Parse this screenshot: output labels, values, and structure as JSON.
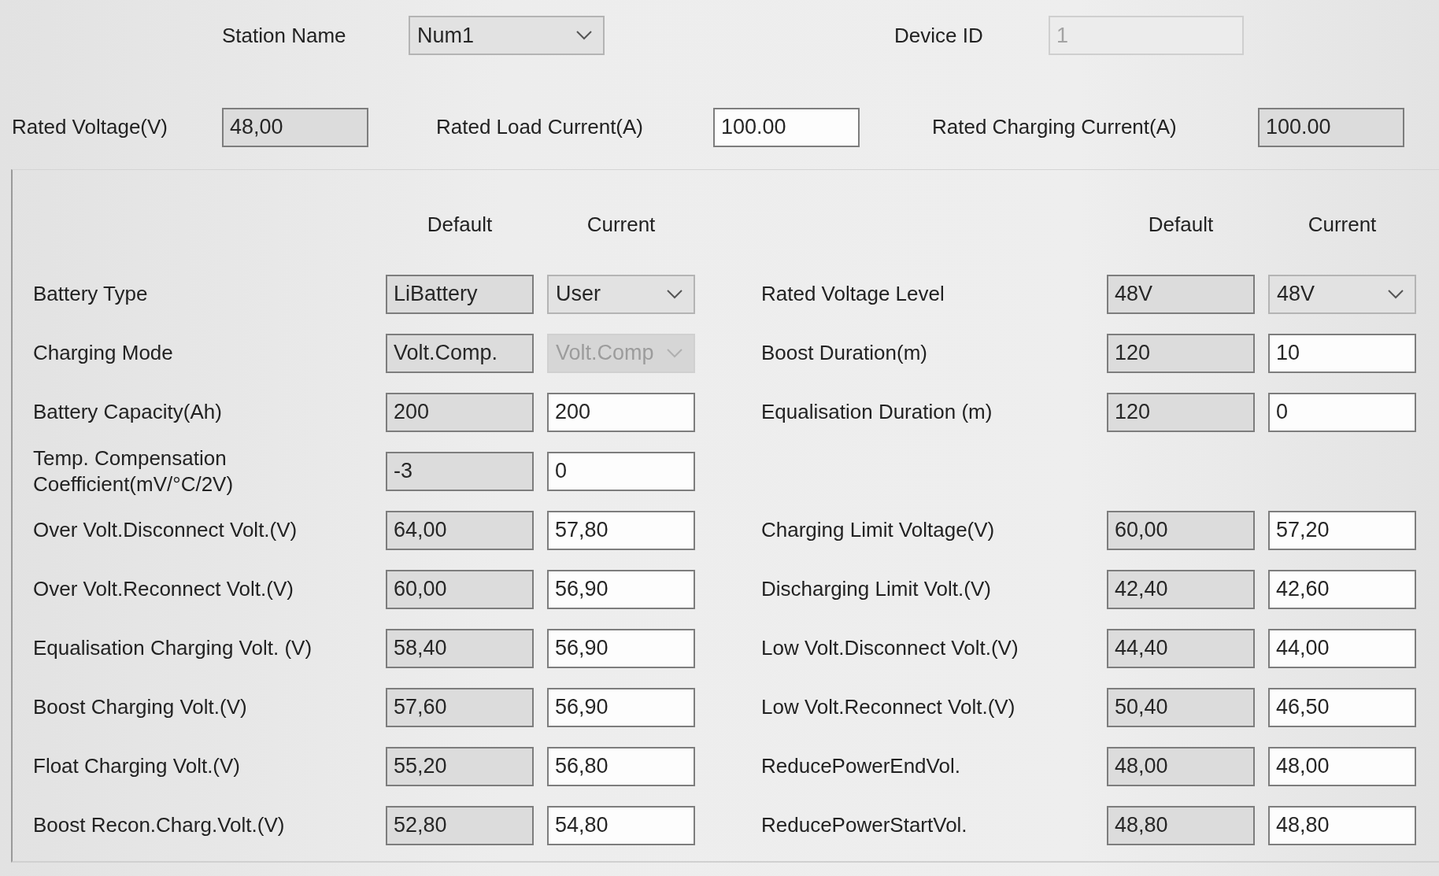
{
  "station": {
    "label": "Station Name",
    "field": {
      "kind": "combo",
      "value": "Num1",
      "disabled": false
    }
  },
  "device": {
    "label": "Device ID",
    "field": {
      "kind": "text",
      "value": "1",
      "disabled": true
    }
  },
  "ratings": [
    {
      "label": "Rated Voltage(V)",
      "field": {
        "kind": "text",
        "value": "48,00",
        "disabled": false,
        "readonly": true
      }
    },
    {
      "label": "Rated Load Current(A)",
      "field": {
        "kind": "text",
        "value": "100.00",
        "disabled": false,
        "readonly": false
      }
    },
    {
      "label": "Rated Charging Current(A)",
      "field": {
        "kind": "text",
        "value": "100.00",
        "disabled": false,
        "readonly": true
      }
    }
  ],
  "left_panel": {
    "column_headers": [
      "Default",
      "Current"
    ],
    "rows": [
      {
        "label": "Battery Type",
        "default": {
          "kind": "text",
          "value": "LiBattery",
          "disabled": false,
          "readonly": true
        },
        "current": {
          "kind": "combo",
          "value": "User",
          "disabled": false
        }
      },
      {
        "label": "Charging Mode",
        "default": {
          "kind": "text",
          "value": "Volt.Comp.",
          "disabled": false,
          "readonly": true
        },
        "current": {
          "kind": "combo",
          "value": "Volt.Comp",
          "disabled": true
        }
      },
      {
        "label": "Battery Capacity(Ah)",
        "default": {
          "kind": "text",
          "value": "200",
          "disabled": false,
          "readonly": true
        },
        "current": {
          "kind": "text",
          "value": "200",
          "disabled": false,
          "readonly": false
        }
      },
      {
        "label": "Temp. Compensation\nCoefficient(mV/°C/2V)",
        "default": {
          "kind": "text",
          "value": "-3",
          "disabled": false,
          "readonly": true
        },
        "current": {
          "kind": "text",
          "value": "0",
          "disabled": false,
          "readonly": false
        }
      },
      {
        "label": "Over Volt.Disconnect Volt.(V)",
        "default": {
          "kind": "text",
          "value": "64,00",
          "disabled": false,
          "readonly": true
        },
        "current": {
          "kind": "text",
          "value": "57,80",
          "disabled": false,
          "readonly": false
        }
      },
      {
        "label": "Over Volt.Reconnect Volt.(V)",
        "default": {
          "kind": "text",
          "value": "60,00",
          "disabled": false,
          "readonly": true
        },
        "current": {
          "kind": "text",
          "value": "56,90",
          "disabled": false,
          "readonly": false
        }
      },
      {
        "label": "Equalisation Charging Volt. (V)",
        "default": {
          "kind": "text",
          "value": "58,40",
          "disabled": false,
          "readonly": true
        },
        "current": {
          "kind": "text",
          "value": "56,90",
          "disabled": false,
          "readonly": false
        }
      },
      {
        "label": "Boost Charging Volt.(V)",
        "default": {
          "kind": "text",
          "value": "57,60",
          "disabled": false,
          "readonly": true
        },
        "current": {
          "kind": "text",
          "value": "56,90",
          "disabled": false,
          "readonly": false
        }
      },
      {
        "label": "Float Charging Volt.(V)",
        "default": {
          "kind": "text",
          "value": "55,20",
          "disabled": false,
          "readonly": true
        },
        "current": {
          "kind": "text",
          "value": "56,80",
          "disabled": false,
          "readonly": false
        }
      },
      {
        "label": "Boost Recon.Charg.Volt.(V)",
        "default": {
          "kind": "text",
          "value": "52,80",
          "disabled": false,
          "readonly": true
        },
        "current": {
          "kind": "text",
          "value": "54,80",
          "disabled": false,
          "readonly": false
        }
      }
    ]
  },
  "right_panel": {
    "column_headers": [
      "Default",
      "Current"
    ],
    "groups": [
      {
        "rows": [
          {
            "label": "Rated Voltage Level",
            "default": {
              "kind": "text",
              "value": "48V",
              "disabled": false,
              "readonly": true
            },
            "current": {
              "kind": "combo",
              "value": "48V",
              "disabled": false
            }
          },
          {
            "label": "Boost Duration(m)",
            "default": {
              "kind": "text",
              "value": "120",
              "disabled": false,
              "readonly": true
            },
            "current": {
              "kind": "text",
              "value": "10",
              "disabled": false,
              "readonly": false
            }
          },
          {
            "label": "Equalisation Duration (m)",
            "default": {
              "kind": "text",
              "value": "120",
              "disabled": false,
              "readonly": true
            },
            "current": {
              "kind": "text",
              "value": "0",
              "disabled": false,
              "readonly": false
            }
          }
        ]
      },
      {
        "rows": [
          {
            "label": "Charging Limit Voltage(V)",
            "default": {
              "kind": "text",
              "value": "60,00",
              "disabled": false,
              "readonly": true
            },
            "current": {
              "kind": "text",
              "value": "57,20",
              "disabled": false,
              "readonly": false
            }
          },
          {
            "label": "Discharging Limit Volt.(V)",
            "default": {
              "kind": "text",
              "value": "42,40",
              "disabled": false,
              "readonly": true
            },
            "current": {
              "kind": "text",
              "value": "42,60",
              "disabled": false,
              "readonly": false
            }
          },
          {
            "label": "Low Volt.Disconnect Volt.(V)",
            "default": {
              "kind": "text",
              "value": "44,40",
              "disabled": false,
              "readonly": true
            },
            "current": {
              "kind": "text",
              "value": "44,00",
              "disabled": false,
              "readonly": false
            }
          },
          {
            "label": "Low Volt.Reconnect Volt.(V)",
            "default": {
              "kind": "text",
              "value": "50,40",
              "disabled": false,
              "readonly": true
            },
            "current": {
              "kind": "text",
              "value": "46,50",
              "disabled": false,
              "readonly": false
            }
          },
          {
            "label": "ReducePowerEndVol.",
            "default": {
              "kind": "text",
              "value": "48,00",
              "disabled": false,
              "readonly": true
            },
            "current": {
              "kind": "text",
              "value": "48,00",
              "disabled": false,
              "readonly": false
            }
          },
          {
            "label": "ReducePowerStartVol.",
            "default": {
              "kind": "text",
              "value": "48,80",
              "disabled": false,
              "readonly": true
            },
            "current": {
              "kind": "text",
              "value": "48,80",
              "disabled": false,
              "readonly": false
            }
          }
        ]
      }
    ]
  }
}
